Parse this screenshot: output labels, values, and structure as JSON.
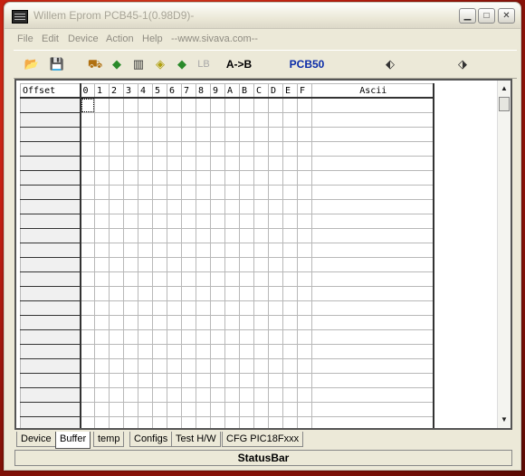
{
  "window": {
    "title": "Willem Eprom PCB45-1(0.98D9)-"
  },
  "menubar": {
    "items": [
      "File",
      "Edit",
      "Device",
      "Action",
      "Help",
      "--www.sivava.com--"
    ]
  },
  "toolbar": {
    "lb_label": "LB",
    "atob_label": "A->B",
    "pcb_label": "PCB50",
    "pcb_color": "#0a2ca8"
  },
  "grid": {
    "offset_header": "Offset",
    "columns": [
      "0",
      "1",
      "2",
      "3",
      "4",
      "5",
      "6",
      "7",
      "8",
      "9",
      "A",
      "B",
      "C",
      "D",
      "E",
      "F"
    ],
    "ascii_header": "Ascii"
  },
  "tabs": [
    "Device",
    "Buffer",
    "temp",
    "Configs",
    "Test H/W",
    "CFG PIC18Fxxx"
  ],
  "active_tab": "Buffer",
  "statusbar": {
    "text": "StatusBar"
  }
}
